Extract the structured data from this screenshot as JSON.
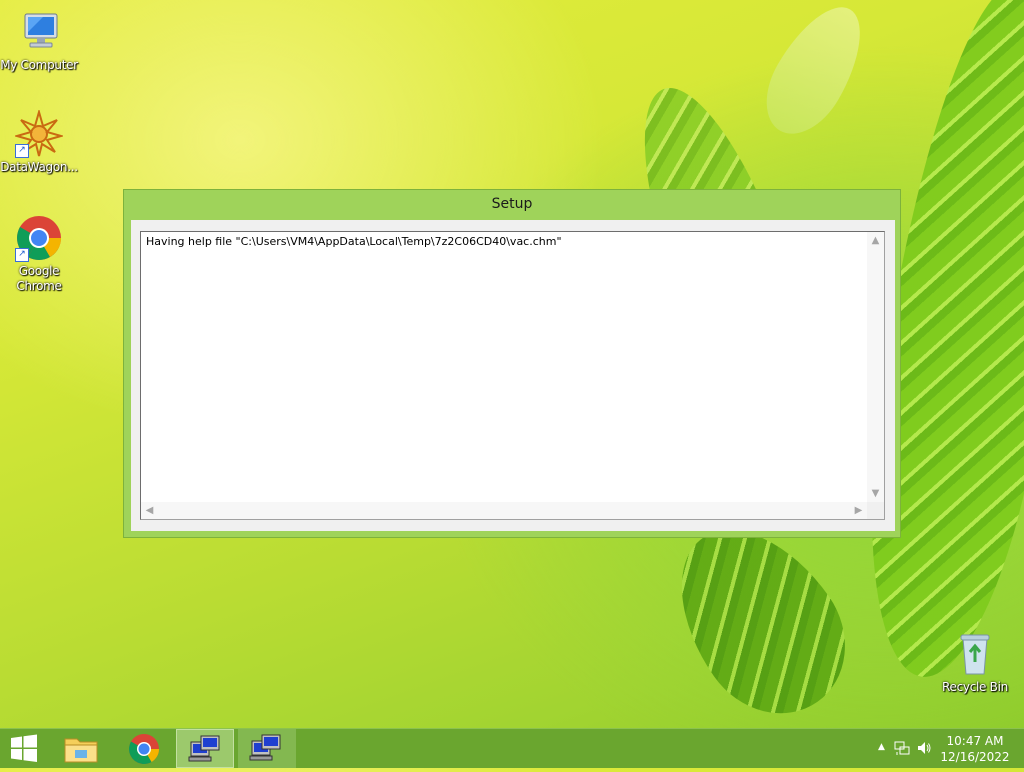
{
  "desktop": {
    "icons": [
      {
        "label": "My Computer",
        "icon": "computer-icon"
      },
      {
        "label": "DataWagon...",
        "icon": "datawagon-icon"
      },
      {
        "label": "Google Chrome",
        "icon": "chrome-icon"
      },
      {
        "label": "Recycle Bin",
        "icon": "recycle-bin-icon"
      }
    ]
  },
  "window": {
    "title": "Setup",
    "log_text": "Having help file \"C:\\Users\\VM4\\AppData\\Local\\Temp\\7z2C06CD40\\vac.chm\""
  },
  "taskbar": {
    "items": [
      {
        "name": "start-button",
        "icon": "windows-logo-icon"
      },
      {
        "name": "file-explorer",
        "icon": "folder-icon"
      },
      {
        "name": "google-chrome",
        "icon": "chrome-icon"
      },
      {
        "name": "setup-app-1",
        "icon": "setup-computer-icon",
        "active": true
      },
      {
        "name": "setup-app-2",
        "icon": "setup-computer-icon",
        "active": false
      }
    ],
    "time": "10:47 AM",
    "date": "12/16/2022"
  },
  "colors": {
    "window_frame": "#9fd35a",
    "taskbar": "#6aa62f"
  }
}
